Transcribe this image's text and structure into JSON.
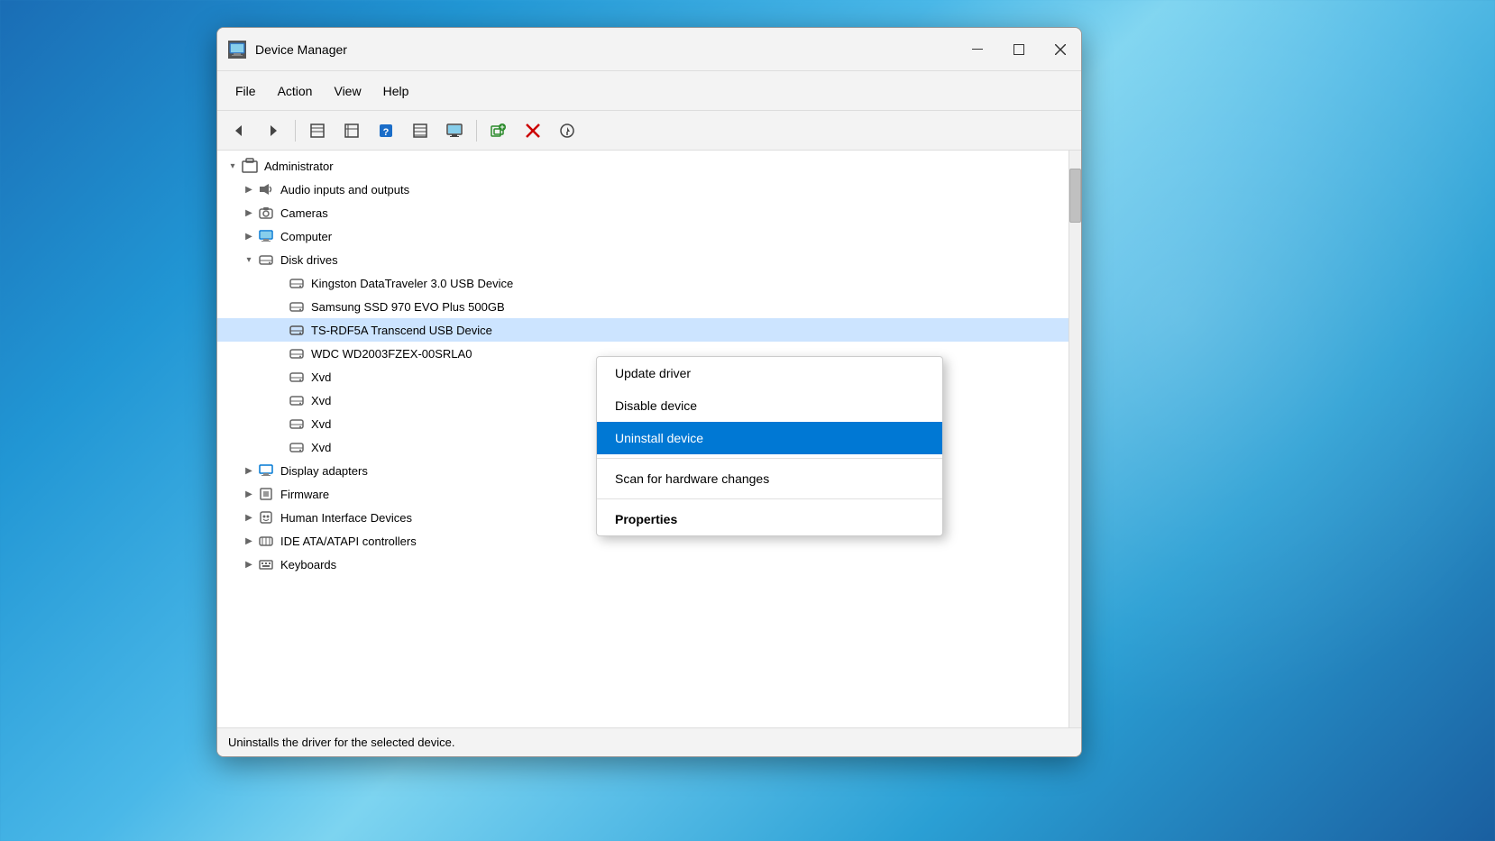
{
  "window": {
    "title": "Device Manager",
    "icon": "device-manager-icon"
  },
  "window_controls": {
    "minimize": "—",
    "maximize": "□",
    "close": "✕"
  },
  "menu_bar": {
    "items": [
      {
        "id": "file",
        "label": "File"
      },
      {
        "id": "action",
        "label": "Action"
      },
      {
        "id": "view",
        "label": "View"
      },
      {
        "id": "help",
        "label": "Help"
      }
    ]
  },
  "toolbar": {
    "buttons": [
      {
        "id": "back",
        "icon": "←",
        "tooltip": "Back",
        "disabled": false
      },
      {
        "id": "forward",
        "icon": "→",
        "tooltip": "Forward",
        "disabled": false
      },
      {
        "id": "properties",
        "icon": "▦",
        "tooltip": "Properties",
        "disabled": false
      },
      {
        "id": "update",
        "icon": "⊞",
        "tooltip": "Update Driver",
        "disabled": false
      },
      {
        "id": "help",
        "icon": "?",
        "tooltip": "Help",
        "disabled": false
      },
      {
        "id": "view-resources",
        "icon": "≡",
        "tooltip": "View Resources",
        "disabled": false
      },
      {
        "id": "monitor",
        "icon": "🖥",
        "tooltip": "Monitor",
        "disabled": false
      },
      {
        "id": "add-device",
        "icon": "➕",
        "tooltip": "Add Device",
        "disabled": false
      },
      {
        "id": "remove",
        "icon": "✕",
        "tooltip": "Remove",
        "disabled": false,
        "red": true
      },
      {
        "id": "scan",
        "icon": "⬇",
        "tooltip": "Scan for changes",
        "disabled": false
      }
    ]
  },
  "tree": {
    "root": {
      "label": "Administrator",
      "expanded": true
    },
    "items": [
      {
        "id": "audio",
        "label": "Audio inputs and outputs",
        "level": 1,
        "expanded": false,
        "icon": "audio"
      },
      {
        "id": "cameras",
        "label": "Cameras",
        "level": 1,
        "expanded": false,
        "icon": "camera"
      },
      {
        "id": "computer",
        "label": "Computer",
        "level": 1,
        "expanded": false,
        "icon": "computer"
      },
      {
        "id": "disk-drives",
        "label": "Disk drives",
        "level": 1,
        "expanded": true,
        "icon": "disk"
      },
      {
        "id": "kingston",
        "label": "Kingston DataTraveler 3.0 USB Device",
        "level": 2,
        "icon": "disk"
      },
      {
        "id": "samsung",
        "label": "Samsung SSD 970 EVO Plus 500GB",
        "level": 2,
        "icon": "disk"
      },
      {
        "id": "ts-rdf5a",
        "label": "TS-RDF5A Transcend USB Device",
        "level": 2,
        "icon": "disk",
        "selected": true
      },
      {
        "id": "wdc",
        "label": "WDC WD2003FZEX-00SRLA0",
        "level": 2,
        "icon": "disk"
      },
      {
        "id": "xvd1",
        "label": "Xvd",
        "level": 2,
        "icon": "disk"
      },
      {
        "id": "xvd2",
        "label": "Xvd",
        "level": 2,
        "icon": "disk"
      },
      {
        "id": "xvd3",
        "label": "Xvd",
        "level": 2,
        "icon": "disk"
      },
      {
        "id": "xvd4",
        "label": "Xvd",
        "level": 2,
        "icon": "disk"
      },
      {
        "id": "display-adapters",
        "label": "Display adapters",
        "level": 1,
        "expanded": false,
        "icon": "display"
      },
      {
        "id": "firmware",
        "label": "Firmware",
        "level": 1,
        "expanded": false,
        "icon": "firmware"
      },
      {
        "id": "hid",
        "label": "Human Interface Devices",
        "level": 1,
        "expanded": false,
        "icon": "hid"
      },
      {
        "id": "ide",
        "label": "IDE ATA/ATAPI controllers",
        "level": 1,
        "expanded": false,
        "icon": "ide"
      },
      {
        "id": "keyboards",
        "label": "Keyboards",
        "level": 1,
        "expanded": false,
        "icon": "keyboard"
      }
    ]
  },
  "context_menu": {
    "items": [
      {
        "id": "update-driver",
        "label": "Update driver",
        "active": false
      },
      {
        "id": "disable-device",
        "label": "Disable device",
        "active": false
      },
      {
        "id": "uninstall-device",
        "label": "Uninstall device",
        "active": true
      },
      {
        "id": "scan-hardware",
        "label": "Scan for hardware changes",
        "active": false
      },
      {
        "id": "properties",
        "label": "Properties",
        "active": false,
        "bold": true
      }
    ]
  },
  "status_bar": {
    "text": "Uninstalls the driver for the selected device."
  }
}
